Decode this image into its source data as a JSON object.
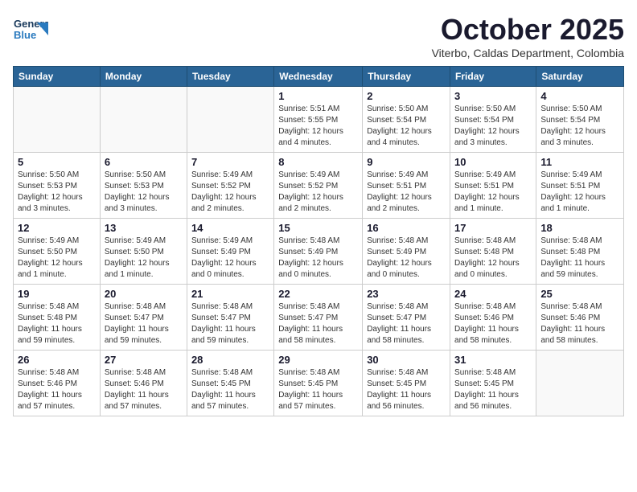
{
  "header": {
    "logo_line1": "General",
    "logo_line2": "Blue",
    "title": "October 2025",
    "subtitle": "Viterbo, Caldas Department, Colombia"
  },
  "weekdays": [
    "Sunday",
    "Monday",
    "Tuesday",
    "Wednesday",
    "Thursday",
    "Friday",
    "Saturday"
  ],
  "weeks": [
    [
      {
        "date": "",
        "info": ""
      },
      {
        "date": "",
        "info": ""
      },
      {
        "date": "",
        "info": ""
      },
      {
        "date": "1",
        "info": "Sunrise: 5:51 AM\nSunset: 5:55 PM\nDaylight: 12 hours\nand 4 minutes."
      },
      {
        "date": "2",
        "info": "Sunrise: 5:50 AM\nSunset: 5:54 PM\nDaylight: 12 hours\nand 4 minutes."
      },
      {
        "date": "3",
        "info": "Sunrise: 5:50 AM\nSunset: 5:54 PM\nDaylight: 12 hours\nand 3 minutes."
      },
      {
        "date": "4",
        "info": "Sunrise: 5:50 AM\nSunset: 5:54 PM\nDaylight: 12 hours\nand 3 minutes."
      }
    ],
    [
      {
        "date": "5",
        "info": "Sunrise: 5:50 AM\nSunset: 5:53 PM\nDaylight: 12 hours\nand 3 minutes."
      },
      {
        "date": "6",
        "info": "Sunrise: 5:50 AM\nSunset: 5:53 PM\nDaylight: 12 hours\nand 3 minutes."
      },
      {
        "date": "7",
        "info": "Sunrise: 5:49 AM\nSunset: 5:52 PM\nDaylight: 12 hours\nand 2 minutes."
      },
      {
        "date": "8",
        "info": "Sunrise: 5:49 AM\nSunset: 5:52 PM\nDaylight: 12 hours\nand 2 minutes."
      },
      {
        "date": "9",
        "info": "Sunrise: 5:49 AM\nSunset: 5:51 PM\nDaylight: 12 hours\nand 2 minutes."
      },
      {
        "date": "10",
        "info": "Sunrise: 5:49 AM\nSunset: 5:51 PM\nDaylight: 12 hours\nand 1 minute."
      },
      {
        "date": "11",
        "info": "Sunrise: 5:49 AM\nSunset: 5:51 PM\nDaylight: 12 hours\nand 1 minute."
      }
    ],
    [
      {
        "date": "12",
        "info": "Sunrise: 5:49 AM\nSunset: 5:50 PM\nDaylight: 12 hours\nand 1 minute."
      },
      {
        "date": "13",
        "info": "Sunrise: 5:49 AM\nSunset: 5:50 PM\nDaylight: 12 hours\nand 1 minute."
      },
      {
        "date": "14",
        "info": "Sunrise: 5:49 AM\nSunset: 5:49 PM\nDaylight: 12 hours\nand 0 minutes."
      },
      {
        "date": "15",
        "info": "Sunrise: 5:48 AM\nSunset: 5:49 PM\nDaylight: 12 hours\nand 0 minutes."
      },
      {
        "date": "16",
        "info": "Sunrise: 5:48 AM\nSunset: 5:49 PM\nDaylight: 12 hours\nand 0 minutes."
      },
      {
        "date": "17",
        "info": "Sunrise: 5:48 AM\nSunset: 5:48 PM\nDaylight: 12 hours\nand 0 minutes."
      },
      {
        "date": "18",
        "info": "Sunrise: 5:48 AM\nSunset: 5:48 PM\nDaylight: 11 hours\nand 59 minutes."
      }
    ],
    [
      {
        "date": "19",
        "info": "Sunrise: 5:48 AM\nSunset: 5:48 PM\nDaylight: 11 hours\nand 59 minutes."
      },
      {
        "date": "20",
        "info": "Sunrise: 5:48 AM\nSunset: 5:47 PM\nDaylight: 11 hours\nand 59 minutes."
      },
      {
        "date": "21",
        "info": "Sunrise: 5:48 AM\nSunset: 5:47 PM\nDaylight: 11 hours\nand 59 minutes."
      },
      {
        "date": "22",
        "info": "Sunrise: 5:48 AM\nSunset: 5:47 PM\nDaylight: 11 hours\nand 58 minutes."
      },
      {
        "date": "23",
        "info": "Sunrise: 5:48 AM\nSunset: 5:47 PM\nDaylight: 11 hours\nand 58 minutes."
      },
      {
        "date": "24",
        "info": "Sunrise: 5:48 AM\nSunset: 5:46 PM\nDaylight: 11 hours\nand 58 minutes."
      },
      {
        "date": "25",
        "info": "Sunrise: 5:48 AM\nSunset: 5:46 PM\nDaylight: 11 hours\nand 58 minutes."
      }
    ],
    [
      {
        "date": "26",
        "info": "Sunrise: 5:48 AM\nSunset: 5:46 PM\nDaylight: 11 hours\nand 57 minutes."
      },
      {
        "date": "27",
        "info": "Sunrise: 5:48 AM\nSunset: 5:46 PM\nDaylight: 11 hours\nand 57 minutes."
      },
      {
        "date": "28",
        "info": "Sunrise: 5:48 AM\nSunset: 5:45 PM\nDaylight: 11 hours\nand 57 minutes."
      },
      {
        "date": "29",
        "info": "Sunrise: 5:48 AM\nSunset: 5:45 PM\nDaylight: 11 hours\nand 57 minutes."
      },
      {
        "date": "30",
        "info": "Sunrise: 5:48 AM\nSunset: 5:45 PM\nDaylight: 11 hours\nand 56 minutes."
      },
      {
        "date": "31",
        "info": "Sunrise: 5:48 AM\nSunset: 5:45 PM\nDaylight: 11 hours\nand 56 minutes."
      },
      {
        "date": "",
        "info": ""
      }
    ]
  ]
}
